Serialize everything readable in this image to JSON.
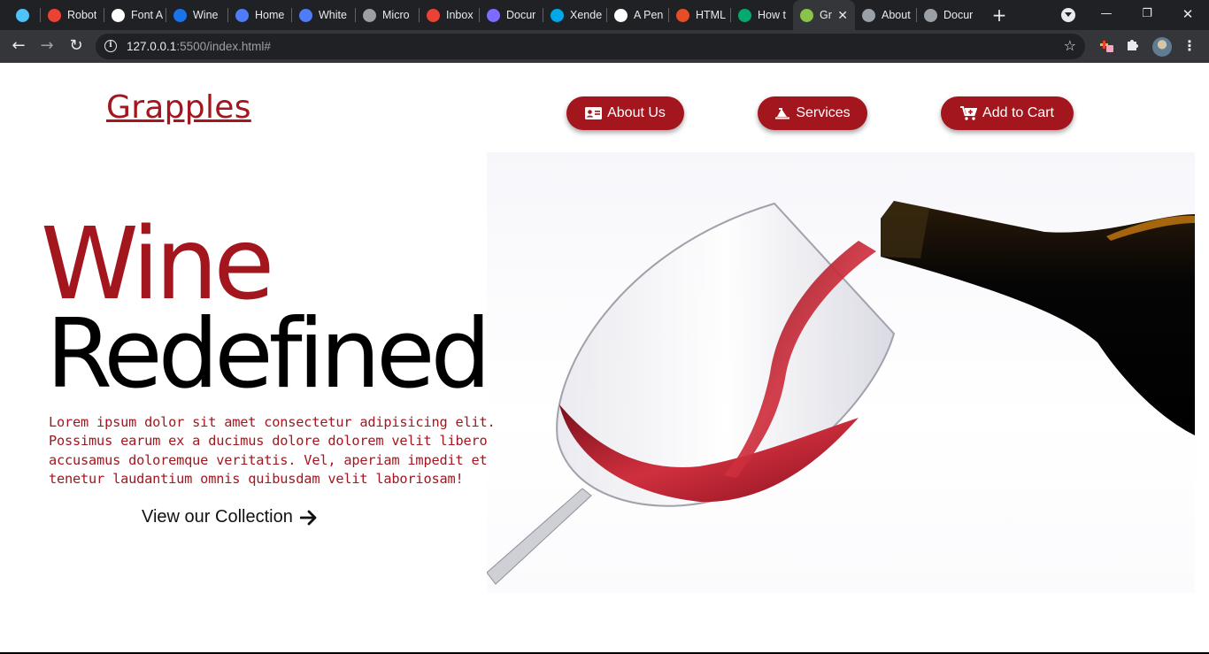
{
  "browser": {
    "tabs": [
      {
        "label": "",
        "icon": "diamond-icon",
        "color": "#4fc3f7"
      },
      {
        "label": "Robot",
        "icon": "robot-icon",
        "color": "#ea4335"
      },
      {
        "label": "Font A",
        "icon": "flag-icon",
        "color": "#ffffff"
      },
      {
        "label": "Wine",
        "icon": "flag-icon",
        "color": "#1a73e8"
      },
      {
        "label": "Home",
        "icon": "c-icon",
        "color": "#4f7cf7"
      },
      {
        "label": "White",
        "icon": "c-icon",
        "color": "#4f7cf7"
      },
      {
        "label": "Micro",
        "icon": "globe-icon",
        "color": "#9aa0a6"
      },
      {
        "label": "Inbox",
        "icon": "gmail-icon",
        "color": "#ea4335"
      },
      {
        "label": "Docur",
        "icon": "gear-icon",
        "color": "#7c6cff"
      },
      {
        "label": "Xende",
        "icon": "x-icon",
        "color": "#00a8e8"
      },
      {
        "label": "A Pen",
        "icon": "codepen-icon",
        "color": "#ffffff"
      },
      {
        "label": "HTML",
        "icon": "html-icon",
        "color": "#e44d26"
      },
      {
        "label": "How t",
        "icon": "w3-icon",
        "color": "#04aa6d"
      },
      {
        "label": "Gr",
        "icon": "wine-glass-icon",
        "color": "#8bc34a"
      },
      {
        "label": "About",
        "icon": "globe-icon",
        "color": "#9aa0a6"
      },
      {
        "label": "Docur",
        "icon": "globe-icon",
        "color": "#9aa0a6"
      }
    ],
    "active_tab_index": 13,
    "url_host": "127.0.0.1",
    "url_rest": ":5500/index.html#"
  },
  "site": {
    "brand": "Grapples",
    "nav": {
      "about": "About Us",
      "services": "Services",
      "cart": "Add to Cart"
    },
    "hero": {
      "line1": "Wine",
      "line2": "Redefined",
      "body": "Lorem ipsum dolor sit amet consectetur adipisicing elit. Possimus earum ex a ducimus dolore dolorem velit libero accusamus doloremque veritatis. Vel, aperiam impedit et tenetur laudantium omnis quibusdam velit laboriosam!",
      "cta": "View our Collection"
    },
    "accent_color": "#a3161d"
  }
}
